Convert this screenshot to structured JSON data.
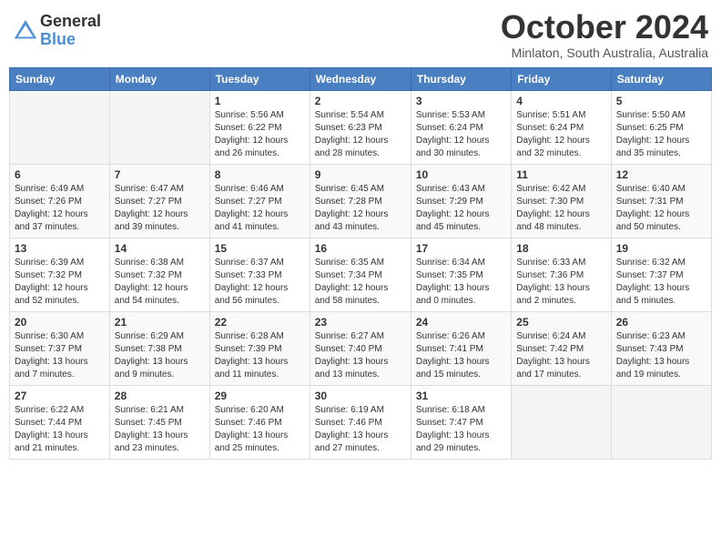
{
  "logo": {
    "general": "General",
    "blue": "Blue"
  },
  "header": {
    "title": "October 2024",
    "subtitle": "Minlaton, South Australia, Australia"
  },
  "weekdays": [
    "Sunday",
    "Monday",
    "Tuesday",
    "Wednesday",
    "Thursday",
    "Friday",
    "Saturday"
  ],
  "weeks": [
    [
      {
        "day": "",
        "info": ""
      },
      {
        "day": "",
        "info": ""
      },
      {
        "day": "1",
        "info": "Sunrise: 5:56 AM\nSunset: 6:22 PM\nDaylight: 12 hours\nand 26 minutes."
      },
      {
        "day": "2",
        "info": "Sunrise: 5:54 AM\nSunset: 6:23 PM\nDaylight: 12 hours\nand 28 minutes."
      },
      {
        "day": "3",
        "info": "Sunrise: 5:53 AM\nSunset: 6:24 PM\nDaylight: 12 hours\nand 30 minutes."
      },
      {
        "day": "4",
        "info": "Sunrise: 5:51 AM\nSunset: 6:24 PM\nDaylight: 12 hours\nand 32 minutes."
      },
      {
        "day": "5",
        "info": "Sunrise: 5:50 AM\nSunset: 6:25 PM\nDaylight: 12 hours\nand 35 minutes."
      }
    ],
    [
      {
        "day": "6",
        "info": "Sunrise: 6:49 AM\nSunset: 7:26 PM\nDaylight: 12 hours\nand 37 minutes."
      },
      {
        "day": "7",
        "info": "Sunrise: 6:47 AM\nSunset: 7:27 PM\nDaylight: 12 hours\nand 39 minutes."
      },
      {
        "day": "8",
        "info": "Sunrise: 6:46 AM\nSunset: 7:27 PM\nDaylight: 12 hours\nand 41 minutes."
      },
      {
        "day": "9",
        "info": "Sunrise: 6:45 AM\nSunset: 7:28 PM\nDaylight: 12 hours\nand 43 minutes."
      },
      {
        "day": "10",
        "info": "Sunrise: 6:43 AM\nSunset: 7:29 PM\nDaylight: 12 hours\nand 45 minutes."
      },
      {
        "day": "11",
        "info": "Sunrise: 6:42 AM\nSunset: 7:30 PM\nDaylight: 12 hours\nand 48 minutes."
      },
      {
        "day": "12",
        "info": "Sunrise: 6:40 AM\nSunset: 7:31 PM\nDaylight: 12 hours\nand 50 minutes."
      }
    ],
    [
      {
        "day": "13",
        "info": "Sunrise: 6:39 AM\nSunset: 7:32 PM\nDaylight: 12 hours\nand 52 minutes."
      },
      {
        "day": "14",
        "info": "Sunrise: 6:38 AM\nSunset: 7:32 PM\nDaylight: 12 hours\nand 54 minutes."
      },
      {
        "day": "15",
        "info": "Sunrise: 6:37 AM\nSunset: 7:33 PM\nDaylight: 12 hours\nand 56 minutes."
      },
      {
        "day": "16",
        "info": "Sunrise: 6:35 AM\nSunset: 7:34 PM\nDaylight: 12 hours\nand 58 minutes."
      },
      {
        "day": "17",
        "info": "Sunrise: 6:34 AM\nSunset: 7:35 PM\nDaylight: 13 hours\nand 0 minutes."
      },
      {
        "day": "18",
        "info": "Sunrise: 6:33 AM\nSunset: 7:36 PM\nDaylight: 13 hours\nand 2 minutes."
      },
      {
        "day": "19",
        "info": "Sunrise: 6:32 AM\nSunset: 7:37 PM\nDaylight: 13 hours\nand 5 minutes."
      }
    ],
    [
      {
        "day": "20",
        "info": "Sunrise: 6:30 AM\nSunset: 7:37 PM\nDaylight: 13 hours\nand 7 minutes."
      },
      {
        "day": "21",
        "info": "Sunrise: 6:29 AM\nSunset: 7:38 PM\nDaylight: 13 hours\nand 9 minutes."
      },
      {
        "day": "22",
        "info": "Sunrise: 6:28 AM\nSunset: 7:39 PM\nDaylight: 13 hours\nand 11 minutes."
      },
      {
        "day": "23",
        "info": "Sunrise: 6:27 AM\nSunset: 7:40 PM\nDaylight: 13 hours\nand 13 minutes."
      },
      {
        "day": "24",
        "info": "Sunrise: 6:26 AM\nSunset: 7:41 PM\nDaylight: 13 hours\nand 15 minutes."
      },
      {
        "day": "25",
        "info": "Sunrise: 6:24 AM\nSunset: 7:42 PM\nDaylight: 13 hours\nand 17 minutes."
      },
      {
        "day": "26",
        "info": "Sunrise: 6:23 AM\nSunset: 7:43 PM\nDaylight: 13 hours\nand 19 minutes."
      }
    ],
    [
      {
        "day": "27",
        "info": "Sunrise: 6:22 AM\nSunset: 7:44 PM\nDaylight: 13 hours\nand 21 minutes."
      },
      {
        "day": "28",
        "info": "Sunrise: 6:21 AM\nSunset: 7:45 PM\nDaylight: 13 hours\nand 23 minutes."
      },
      {
        "day": "29",
        "info": "Sunrise: 6:20 AM\nSunset: 7:46 PM\nDaylight: 13 hours\nand 25 minutes."
      },
      {
        "day": "30",
        "info": "Sunrise: 6:19 AM\nSunset: 7:46 PM\nDaylight: 13 hours\nand 27 minutes."
      },
      {
        "day": "31",
        "info": "Sunrise: 6:18 AM\nSunset: 7:47 PM\nDaylight: 13 hours\nand 29 minutes."
      },
      {
        "day": "",
        "info": ""
      },
      {
        "day": "",
        "info": ""
      }
    ]
  ]
}
